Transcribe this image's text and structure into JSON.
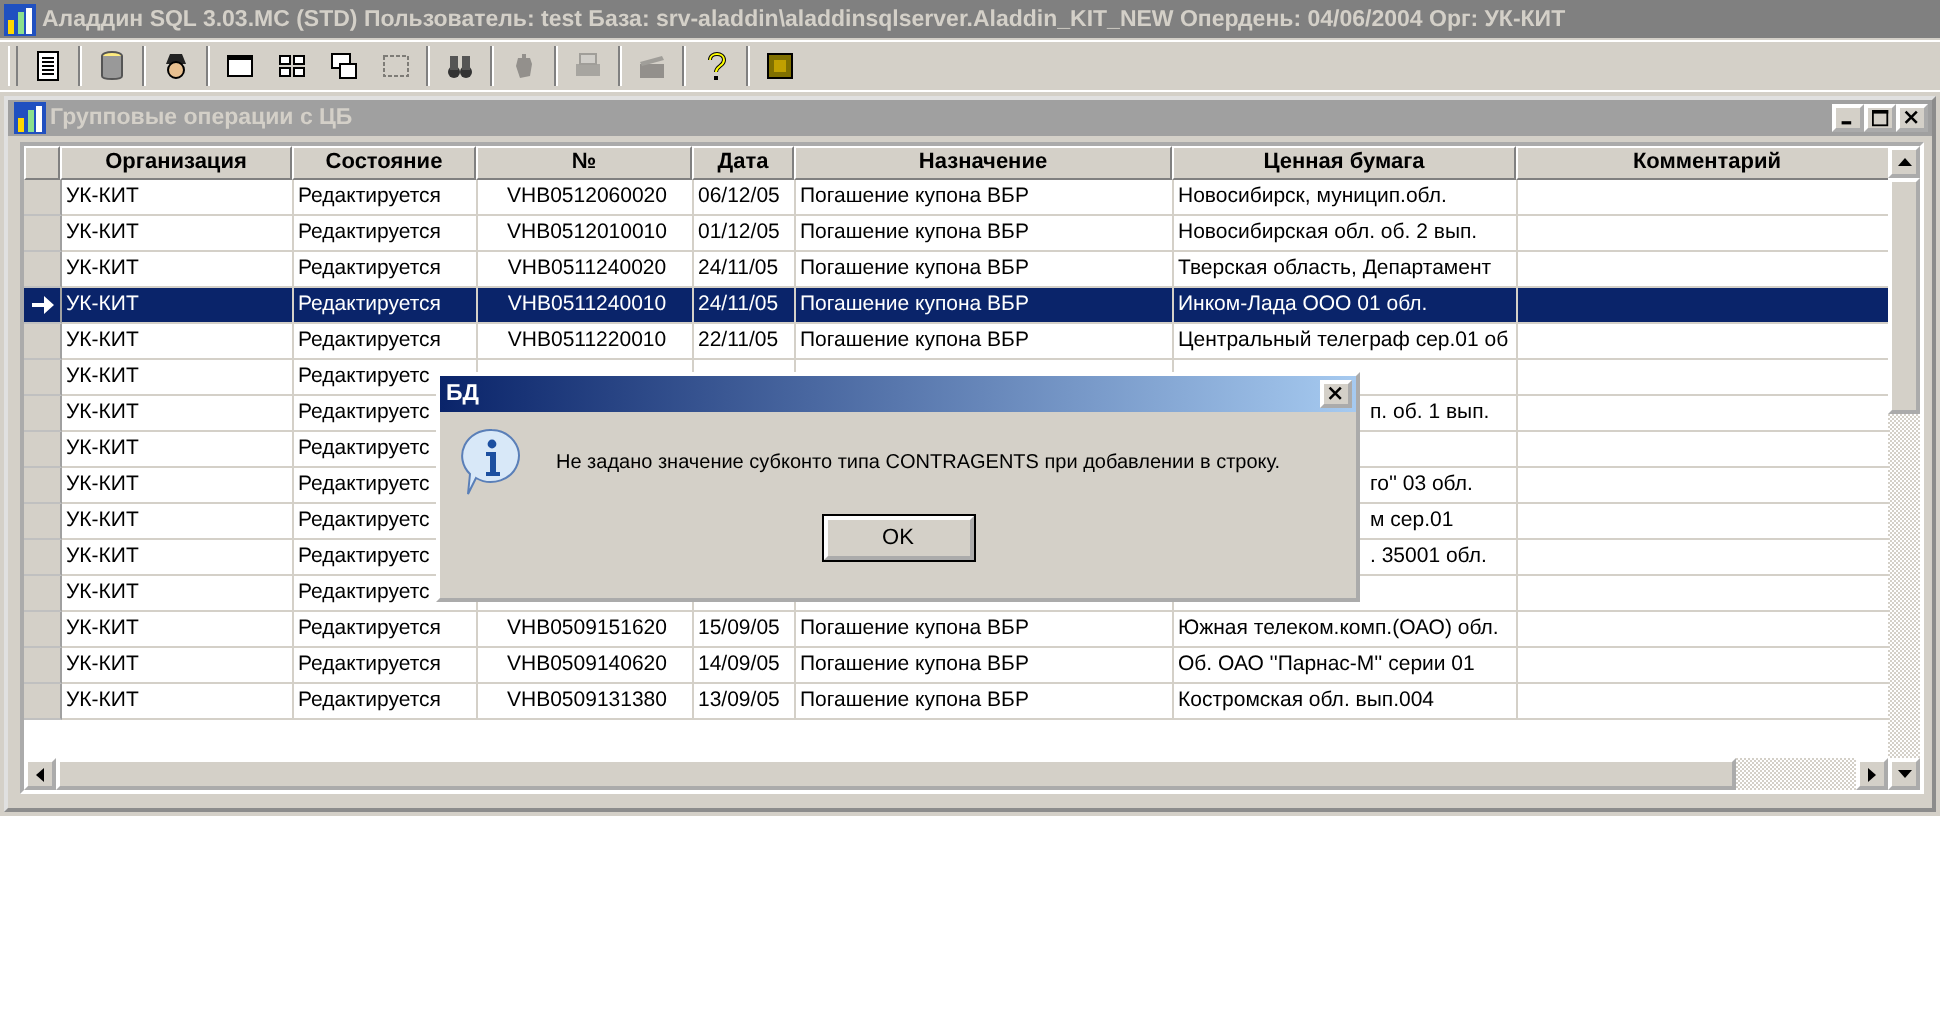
{
  "app_title": "Аладдин SQL 3.03.MC (STD)  Пользователь: test База: srv-aladdin\\aladdinsqlserver.Aladdin_KIT_NEW Опердень: 04/06/2004 Орг: УК-КИТ",
  "toolbar": [
    {
      "kind": "list",
      "disabled": false
    },
    {
      "kind": "database",
      "disabled": false
    },
    {
      "kind": "spy",
      "disabled": false
    },
    {
      "kind": "window",
      "disabled": false
    },
    {
      "kind": "tile",
      "disabled": false
    },
    {
      "kind": "cascade",
      "disabled": false
    },
    {
      "kind": "frame",
      "disabled": true
    },
    {
      "kind": "binoculars",
      "disabled": false
    },
    {
      "kind": "hand",
      "disabled": true
    },
    {
      "kind": "printer",
      "disabled": true
    },
    {
      "kind": "clapper",
      "disabled": true
    },
    {
      "kind": "help",
      "disabled": false
    },
    {
      "kind": "chip",
      "disabled": false
    }
  ],
  "child_window": {
    "title": "Групповые операции с ЦБ"
  },
  "table": {
    "columns": [
      "Организация",
      "Состояние",
      "№",
      "Дата",
      "Назначение",
      "Ценная бумага",
      "Комментарий"
    ],
    "rows": [
      {
        "selected": false,
        "org": "УК-КИТ",
        "state": "Редактируется",
        "number": "VHB0512060020",
        "date": "06/12/05",
        "purpose": "Погашение купона ВБР",
        "security": "Новосибирск, муницип.обл."
      },
      {
        "selected": false,
        "org": "УК-КИТ",
        "state": "Редактируется",
        "number": "VHB0512010010",
        "date": "01/12/05",
        "purpose": "Погашение купона ВБР",
        "security": "Новосибирская обл. об. 2 вып."
      },
      {
        "selected": false,
        "org": "УК-КИТ",
        "state": "Редактируется",
        "number": "VHB0511240020",
        "date": "24/11/05",
        "purpose": "Погашение купона ВБР",
        "security": "Тверская область, Департамент"
      },
      {
        "selected": true,
        "org": "УК-КИТ",
        "state": "Редактируется",
        "number": "VHB0511240010",
        "date": "24/11/05",
        "purpose": "Погашение купона ВБР",
        "security": "Инком-Лада ООО 01 обл."
      },
      {
        "selected": false,
        "org": "УК-КИТ",
        "state": "Редактируется",
        "number": "VHB0511220010",
        "date": "22/11/05",
        "purpose": "Погашение купона ВБР",
        "security": "Центральный телеграф сер.01 об"
      },
      {
        "selected": false,
        "org": "УК-КИТ",
        "state": "Редактируетс"
      },
      {
        "selected": false,
        "org": "УК-КИТ",
        "state": "Редактируетс",
        "security": "п. об. 1 вып."
      },
      {
        "selected": false,
        "org": "УК-КИТ",
        "state": "Редактируетс"
      },
      {
        "selected": false,
        "org": "УК-КИТ",
        "state": "Редактируетс",
        "security": "го'' 03 обл."
      },
      {
        "selected": false,
        "org": "УК-КИТ",
        "state": "Редактируетс",
        "security": "м сер.01"
      },
      {
        "selected": false,
        "org": "УК-КИТ",
        "state": "Редактируетс",
        "security": ". 35001 обл."
      },
      {
        "selected": false,
        "org": "УК-КИТ",
        "state": "Редактируетс"
      },
      {
        "selected": false,
        "org": "УК-КИТ",
        "state": "Редактируется",
        "number": "VHB0509151620",
        "date": "15/09/05",
        "purpose": "Погашение купона ВБР",
        "security": "Южная телеком.комп.(ОАО) обл."
      },
      {
        "selected": false,
        "org": "УК-КИТ",
        "state": "Редактируется",
        "number": "VHB0509140620",
        "date": "14/09/05",
        "purpose": "Погашение купона ВБР",
        "security": "Об. ОАО ''Парнас-М'' серии 01"
      },
      {
        "selected": false,
        "org": "УК-КИТ",
        "state": "Редактируется",
        "number": "VHB0509131380",
        "date": "13/09/05",
        "purpose": "Погашение купона ВБР",
        "security": "Костромская обл. вып.004"
      }
    ]
  },
  "dialog": {
    "title": "БД",
    "message": "Не задано значение субконто типа CONTRAGENTS при добавлении в строку.",
    "button": "OK"
  }
}
